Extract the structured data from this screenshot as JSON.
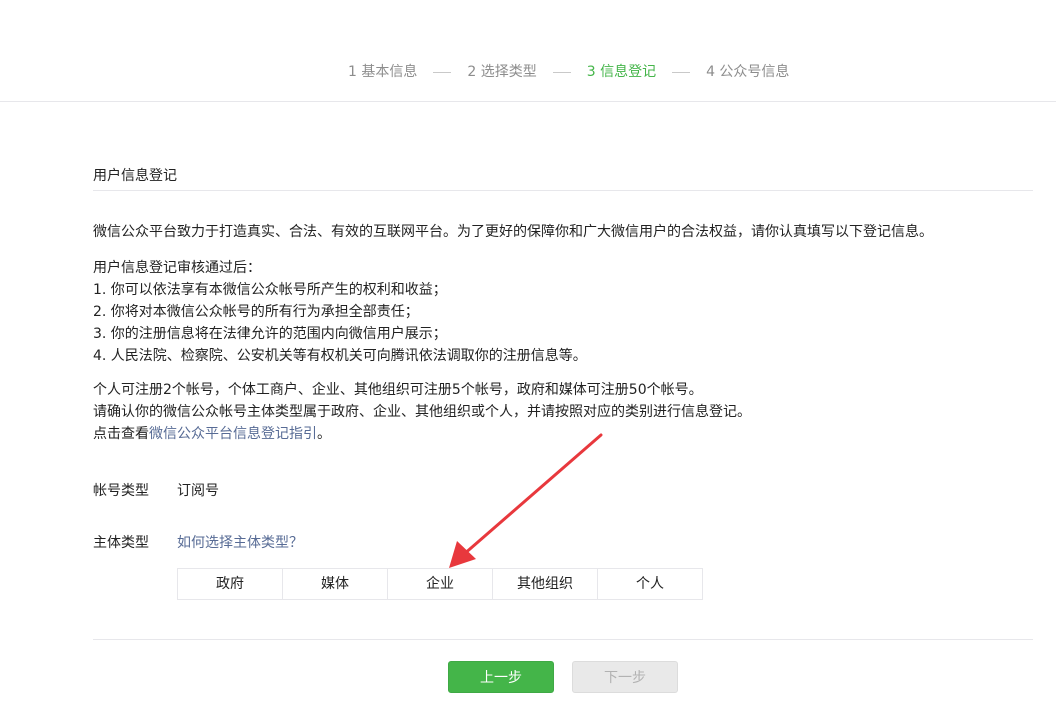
{
  "steps": [
    {
      "label": "1 基本信息"
    },
    {
      "label": "2 选择类型"
    },
    {
      "label": "3 信息登记"
    },
    {
      "label": "4 公众号信息"
    }
  ],
  "active_step": 2,
  "section": {
    "title": "用户信息登记"
  },
  "intro": "微信公众平台致力于打造真实、合法、有效的互联网平台。为了更好的保障你和广大微信用户的合法权益，请你认真填写以下登记信息。",
  "rules": {
    "heading": "用户信息登记审核通过后：",
    "items": [
      "1. 你可以依法享有本微信公众帐号所产生的权利和收益；",
      "2. 你将对本微信公众帐号的所有行为承担全部责任；",
      "3. 你的注册信息将在法律允许的范围内向微信用户展示；",
      "4. 人民法院、检察院、公安机关等有权机关可向腾讯依法调取你的注册信息等。"
    ]
  },
  "limits": {
    "line1": "个人可注册2个帐号，个体工商户、企业、其他组织可注册5个帐号，政府和媒体可注册50个帐号。",
    "line2": "请确认你的微信公众帐号主体类型属于政府、企业、其他组织或个人，并请按照对应的类别进行信息登记。",
    "line3_prefix": "点击查看",
    "line3_link": "微信公众平台信息登记指引",
    "line3_suffix": "。"
  },
  "form": {
    "account_type_label": "帐号类型",
    "account_type_value": "订阅号",
    "subject_type_label": "主体类型",
    "subject_type_help": "如何选择主体类型？"
  },
  "subject_types": [
    {
      "label": "政府"
    },
    {
      "label": "媒体"
    },
    {
      "label": "企业"
    },
    {
      "label": "其他组织"
    },
    {
      "label": "个人"
    }
  ],
  "buttons": {
    "prev": "上一步",
    "next": "下一步"
  },
  "colors": {
    "accent": "#44b549",
    "link": "#576b95",
    "arrow": "#e8383d"
  }
}
